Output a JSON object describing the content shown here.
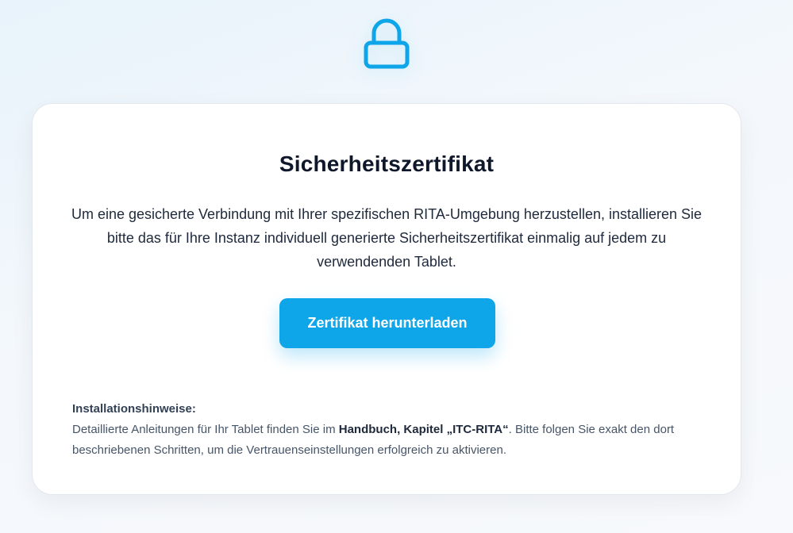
{
  "icon": "lock-icon",
  "colors": {
    "accent": "#0ea5e9",
    "title": "#0f172a",
    "text": "#1e293b",
    "muted": "#475569"
  },
  "card": {
    "title": "Sicherheitszertifikat",
    "intro": "Um eine gesicherte Verbindung mit Ihrer spezifischen RITA-Umgebung herzustellen, installieren Sie bitte das für Ihre Instanz individuell generierte Sicherheitszertifikat einmalig auf jedem zu verwendenden Tablet.",
    "button_label": "Zertifikat herunterladen",
    "notes": {
      "heading": "Installationshinweise:",
      "text_before": "Detaillierte Anleitungen für Ihr Tablet finden Sie im ",
      "reference": "Handbuch, Kapitel „ITC-RITA“",
      "text_after": ". Bitte folgen Sie exakt den dort beschriebenen Schritten, um die Vertrauenseinstellungen erfolgreich zu aktivieren."
    }
  }
}
